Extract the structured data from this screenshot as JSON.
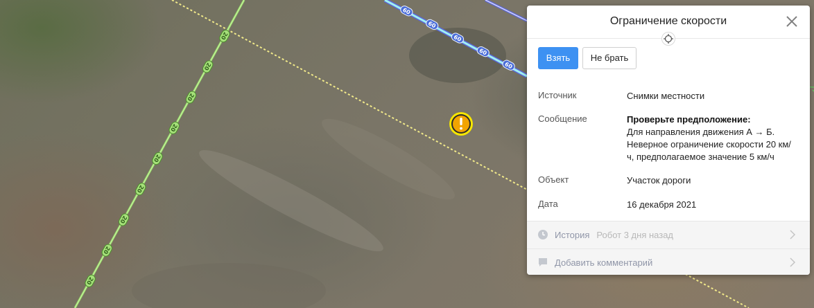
{
  "map": {
    "speed_limit_label": "60",
    "road_sign_label": "20",
    "colors": {
      "road_green": "#9bdd6a",
      "road_cyan": "#9ff0f2",
      "road_blue": "#5b67d8",
      "dotted_line": "#f2ea8a",
      "warning": "#f2a400"
    },
    "warning_icon": "exclamation-icon"
  },
  "card": {
    "title": "Ограничение скорости",
    "take_label": "Взять",
    "skip_label": "Не брать",
    "source_label": "Источник",
    "source_value": "Снимки местности",
    "message_label": "Сообщение",
    "message_head": "Проверьте предположение:",
    "message_line1": "Для направления движения А → Б.",
    "message_line2": "Неверное ограничение скорости 20 км/",
    "message_line3": "ч, предполагаемое значение 5 км/ч",
    "object_label": "Объект",
    "object_value": "Участок дороги",
    "date_label": "Дата",
    "date_value": "16 декабря 2021",
    "history_label": "История",
    "history_sub": "Робот 3 дня назад",
    "comment_label": "Добавить комментарий"
  }
}
